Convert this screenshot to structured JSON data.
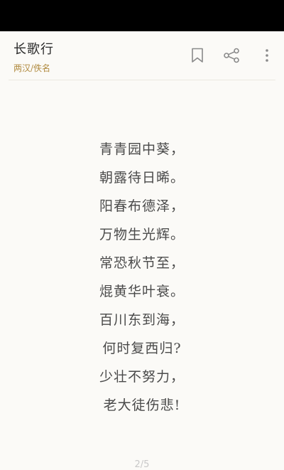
{
  "header": {
    "title": "长歌行",
    "subtitle": "两汉/佚名"
  },
  "toolbar": {
    "bookmark_icon": "bookmark-icon",
    "share_icon": "share-icon",
    "more_icon": "more-vertical-icon"
  },
  "poem": {
    "lines": [
      "青青园中葵，",
      "朝露待日晞。",
      "阳春布德泽，",
      "万物生光辉。",
      "常恐秋节至，",
      "焜黄华叶衰。",
      "百川东到海，",
      "何时复西归?",
      "少壮不努力，",
      "老大徒伤悲!"
    ]
  },
  "pagination": {
    "label": "2/5"
  },
  "colors": {
    "background": "#fbfaf7",
    "accent": "#b08a3e",
    "text": "#4a4a4a",
    "icon": "#8a8a8a"
  }
}
